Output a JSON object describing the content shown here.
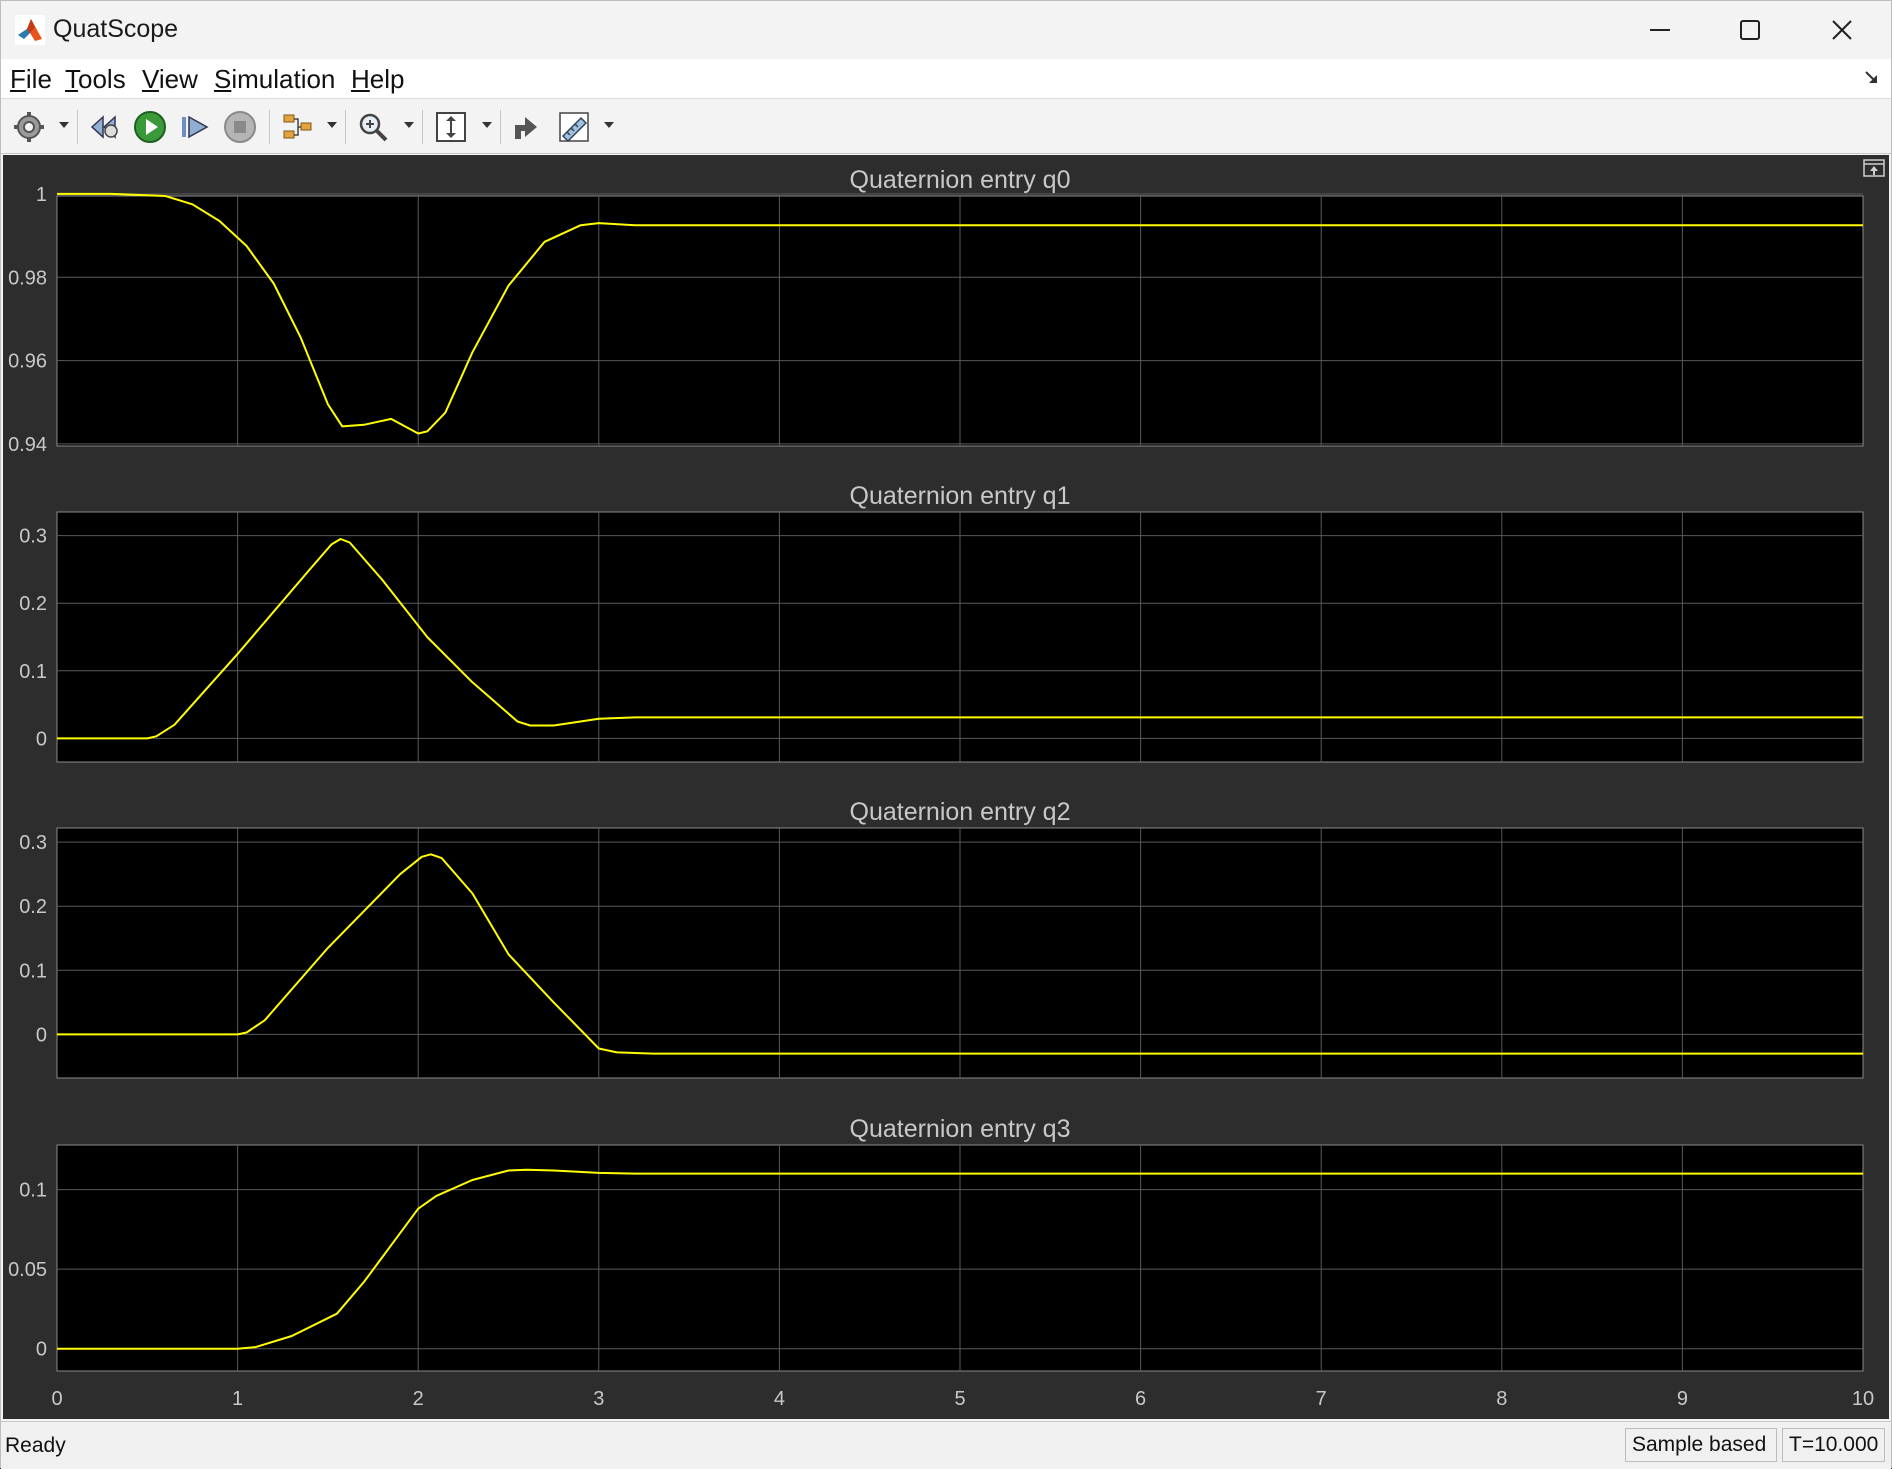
{
  "window": {
    "title": "QuatScope",
    "minimize_glyph": "—",
    "maximize_glyph": "☐",
    "close_glyph": "✕"
  },
  "menu": [
    {
      "label": "File",
      "accel": "F",
      "rest": "ile"
    },
    {
      "label": "Tools",
      "accel": "T",
      "rest": "ools"
    },
    {
      "label": "View",
      "accel": "V",
      "rest": "iew"
    },
    {
      "label": "Simulation",
      "accel": "S",
      "rest": "imulation"
    },
    {
      "label": "Help",
      "accel": "H",
      "rest": "elp"
    }
  ],
  "toolbar": {
    "icons": [
      "settings-icon",
      "step-back-icon",
      "run-icon",
      "step-forward-icon",
      "stop-icon",
      "signal-select-icon",
      "zoom-icon",
      "scale-axes-icon",
      "highlight-icon",
      "measurements-icon"
    ]
  },
  "status": {
    "ready": "Ready",
    "mode": "Sample based",
    "time": "T=10.000"
  },
  "colors": {
    "trace": "#ffff00",
    "plot_bg": "#000000",
    "figure_bg": "#2d2d2d",
    "grid": "#5a5a5a",
    "text": "#c8c8c8"
  },
  "chart_data": [
    {
      "type": "line",
      "title": "Quaternion entry q0",
      "xlim": [
        0,
        10
      ],
      "ylim": [
        0.9395,
        0.9995
      ],
      "yticks": [
        0.94,
        0.96,
        0.98,
        1
      ],
      "ytick_labels": [
        "0.94",
        "0.96",
        "0.98",
        "1"
      ],
      "grid": true,
      "x": [
        0,
        0.3,
        0.6,
        0.75,
        0.9,
        1.05,
        1.2,
        1.35,
        1.5,
        1.58,
        1.7,
        1.85,
        2.0,
        2.05,
        2.15,
        2.3,
        2.5,
        2.7,
        2.9,
        3.0,
        3.2,
        4,
        10
      ],
      "y": [
        1.0,
        1.0,
        0.9995,
        0.9975,
        0.9935,
        0.9875,
        0.9785,
        0.9655,
        0.9495,
        0.9442,
        0.9446,
        0.946,
        0.9425,
        0.943,
        0.9475,
        0.962,
        0.978,
        0.9885,
        0.9925,
        0.993,
        0.9925,
        0.9925,
        0.9925
      ]
    },
    {
      "type": "line",
      "title": "Quaternion entry q1",
      "xlim": [
        0,
        10
      ],
      "ylim": [
        -0.035,
        0.335
      ],
      "yticks": [
        0,
        0.1,
        0.2,
        0.3
      ],
      "ytick_labels": [
        "0",
        "0.1",
        "0.2",
        "0.3"
      ],
      "grid": true,
      "x": [
        0,
        0.5,
        0.55,
        0.65,
        1.0,
        1.4,
        1.52,
        1.57,
        1.62,
        1.8,
        2.05,
        2.3,
        2.55,
        2.62,
        2.75,
        3.0,
        3.2,
        10
      ],
      "y": [
        0,
        0,
        0.003,
        0.02,
        0.125,
        0.25,
        0.287,
        0.295,
        0.29,
        0.235,
        0.15,
        0.083,
        0.025,
        0.019,
        0.019,
        0.029,
        0.031,
        0.031
      ]
    },
    {
      "type": "line",
      "title": "Quaternion entry q2",
      "xlim": [
        0,
        10
      ],
      "ylim": [
        -0.068,
        0.322
      ],
      "yticks": [
        0,
        0.1,
        0.2,
        0.3
      ],
      "ytick_labels": [
        "0",
        "0.1",
        "0.2",
        "0.3"
      ],
      "grid": true,
      "x": [
        0,
        1.0,
        1.05,
        1.15,
        1.5,
        1.9,
        2.02,
        2.07,
        2.13,
        2.3,
        2.5,
        2.75,
        3.0,
        3.1,
        3.3,
        10
      ],
      "y": [
        0,
        0,
        0.003,
        0.022,
        0.135,
        0.25,
        0.277,
        0.281,
        0.275,
        0.22,
        0.125,
        0.05,
        -0.022,
        -0.028,
        -0.03,
        -0.03
      ]
    },
    {
      "type": "line",
      "title": "Quaternion entry q3",
      "xlim": [
        0,
        10
      ],
      "ylim": [
        -0.014,
        0.128
      ],
      "yticks": [
        0,
        0.05,
        0.1
      ],
      "ytick_labels": [
        "0",
        "0.05",
        "0.1"
      ],
      "xticks": [
        0,
        1,
        2,
        3,
        4,
        5,
        6,
        7,
        8,
        9,
        10
      ],
      "xtick_labels": [
        "0",
        "1",
        "2",
        "3",
        "4",
        "5",
        "6",
        "7",
        "8",
        "9",
        "10"
      ],
      "grid": true,
      "x": [
        0,
        1.0,
        1.1,
        1.3,
        1.55,
        1.7,
        1.85,
        2.0,
        2.1,
        2.3,
        2.5,
        2.6,
        2.75,
        3.0,
        3.2,
        10
      ],
      "y": [
        0,
        0,
        0.001,
        0.008,
        0.022,
        0.042,
        0.065,
        0.088,
        0.096,
        0.106,
        0.112,
        0.1125,
        0.112,
        0.1105,
        0.11,
        0.11
      ]
    }
  ]
}
